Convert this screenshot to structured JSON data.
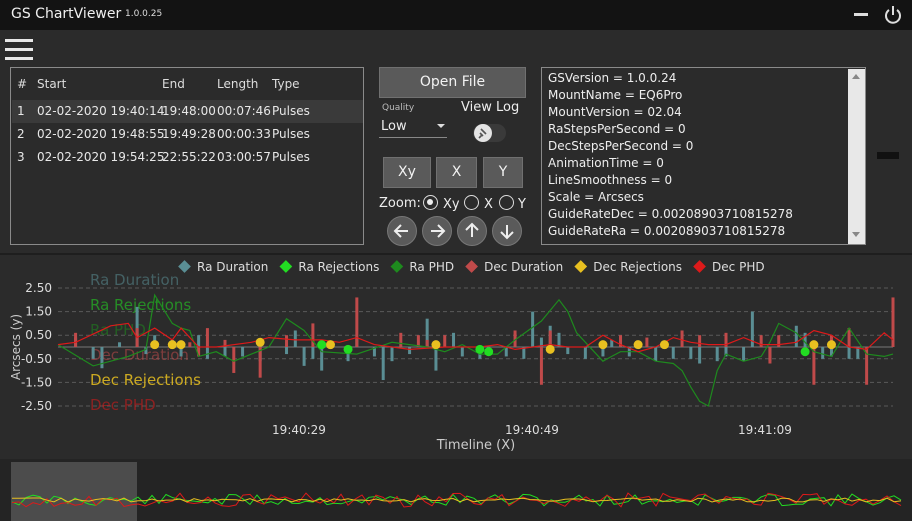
{
  "titlebar": {
    "title": "GS ChartViewer",
    "version": "1.0.0.25"
  },
  "table": {
    "columns": [
      "#",
      "Start",
      "End",
      "Length",
      "Type"
    ],
    "rows": [
      {
        "n": "1",
        "start": "02-02-2020 19:40:14",
        "end": "19:48:00",
        "length": "00:07:46",
        "type": "Pulses"
      },
      {
        "n": "2",
        "start": "02-02-2020 19:48:55",
        "end": "19:49:28",
        "length": "00:00:33",
        "type": "Pulses"
      },
      {
        "n": "3",
        "start": "02-02-2020 19:54:25",
        "end": "22:55:22",
        "length": "03:00:57",
        "type": "Pulses"
      }
    ]
  },
  "controls": {
    "open_file": "Open File",
    "quality_label": "Quality",
    "quality_value": "Low",
    "view_log": "View Log",
    "view_log_on": false,
    "axis_buttons": [
      "Xy",
      "X",
      "Y"
    ],
    "zoom_label": "Zoom:",
    "zoom_options": [
      "Xy",
      "X",
      "Y"
    ],
    "zoom_selected": "Xy"
  },
  "log": {
    "lines": [
      "GSVersion = 1.0.0.24",
      "MountName = EQ6Pro",
      "MountVersion = 02.04",
      "RaStepsPerSecond = 0",
      "DecStepsPerSecond = 0",
      "AnimationTime = 0",
      "LineSmoothness = 0",
      "Scale = Arcsecs",
      "GuideRateDec = 0.00208903710815278",
      "GuideRateRa = 0.00208903710815278"
    ]
  },
  "chart_data": {
    "type": "bar",
    "xlabel": "Timeline (X)",
    "ylabel": "Arcsecs (y)",
    "ylim": [
      -2.5,
      2.5
    ],
    "y_ticks": [
      "2.50",
      "1.50",
      "0.50",
      "-0.50",
      "-1.50",
      "-2.50"
    ],
    "y_tick_values": [
      2.5,
      1.5,
      0.5,
      -0.5,
      -1.5,
      -2.5
    ],
    "x_range": [
      0,
      50
    ],
    "x_ticks": [
      "19:40:29",
      "19:40:49",
      "19:41:09"
    ],
    "x_tick_values": [
      15,
      25,
      35
    ],
    "grid": true,
    "legend_position": "top",
    "colors": {
      "ra_duration": "#5a8e94",
      "ra_rejections": "#22dd22",
      "ra_phd": "#1e8a1e",
      "dec_duration": "#c04a4a",
      "dec_rejections": "#e8c020",
      "dec_phd": "#dd1a1a"
    },
    "legend": [
      {
        "name": "Ra Duration",
        "color": "#5a8e94",
        "shape": "diamond"
      },
      {
        "name": "Ra Rejections",
        "color": "#22dd22",
        "shape": "diamond"
      },
      {
        "name": "Ra PHD",
        "color": "#1e8a1e",
        "shape": "diamond"
      },
      {
        "name": "Dec Duration",
        "color": "#c04a4a",
        "shape": "diamond"
      },
      {
        "name": "Dec Rejections",
        "color": "#e8c020",
        "shape": "diamond"
      },
      {
        "name": "Dec PHD",
        "color": "#dd1a1a",
        "shape": "diamond"
      }
    ],
    "side_labels": [
      "Ra Duration",
      "Ra Rejections",
      "Ra PHD",
      "Dec Duration",
      "Dec Rejections",
      "Dec PHD"
    ],
    "series": [
      {
        "name": "Ra Duration",
        "kind": "bars",
        "points": [
          [
            2,
            0.4
          ],
          [
            4,
            -0.5
          ],
          [
            5,
            -0.9
          ],
          [
            7,
            0.2
          ],
          [
            9,
            1.7
          ],
          [
            10,
            -0.3
          ],
          [
            11,
            0.5
          ],
          [
            13,
            0.3
          ],
          [
            14,
            -0.4
          ],
          [
            16,
            0.5
          ],
          [
            17,
            -0.5
          ],
          [
            19,
            -0.4
          ],
          [
            21,
            -0.4
          ],
          [
            23,
            -0.6
          ],
          [
            26,
            -0.3
          ],
          [
            27,
            0.7
          ],
          [
            28,
            -0.8
          ],
          [
            29,
            -0.5
          ],
          [
            30,
            -1.0
          ],
          [
            33,
            -0.6
          ],
          [
            34,
            0.4
          ],
          [
            36,
            -0.4
          ],
          [
            37,
            -1.4
          ],
          [
            38,
            -0.6
          ],
          [
            40,
            -0.3
          ],
          [
            42,
            1.2
          ],
          [
            43,
            -1.0
          ],
          [
            45,
            0.6
          ],
          [
            46,
            -0.4
          ],
          [
            48,
            -0.5
          ],
          [
            49,
            -0.3
          ],
          [
            51,
            -0.4
          ],
          [
            53,
            -0.5
          ],
          [
            54,
            1.5
          ],
          [
            55,
            0.4
          ],
          [
            56,
            0.9
          ],
          [
            57,
            0.6
          ],
          [
            58,
            -0.3
          ],
          [
            60,
            -0.5
          ],
          [
            62,
            -0.4
          ],
          [
            63,
            0.3
          ],
          [
            65,
            -0.4
          ],
          [
            68,
            -0.6
          ],
          [
            70,
            -0.5
          ],
          [
            72,
            -0.5
          ],
          [
            73,
            -0.7
          ],
          [
            75,
            -0.6
          ],
          [
            76,
            -0.4
          ],
          [
            78,
            -0.6
          ],
          [
            79,
            1.5
          ],
          [
            81,
            -0.6
          ],
          [
            84,
            0.9
          ],
          [
            85,
            0.6
          ],
          [
            87,
            -0.5
          ],
          [
            88,
            -0.4
          ],
          [
            90,
            -0.5
          ],
          [
            91,
            -0.5
          ]
        ]
      },
      {
        "name": "Dec Duration",
        "kind": "bars",
        "points": [
          [
            2,
            0.6
          ],
          [
            9,
            0.8
          ],
          [
            15,
            0.2
          ],
          [
            16,
            -0.4
          ],
          [
            17,
            0.8
          ],
          [
            19,
            0.3
          ],
          [
            20,
            -1.1
          ],
          [
            23,
            -1.3
          ],
          [
            26,
            0.5
          ],
          [
            29,
            1.0
          ],
          [
            34,
            2.1
          ],
          [
            39,
            0.6
          ],
          [
            41,
            0.5
          ],
          [
            42,
            0.3
          ],
          [
            44,
            0.5
          ],
          [
            52,
            0.7
          ],
          [
            55,
            -1.6
          ],
          [
            56,
            0.7
          ],
          [
            64,
            0.5
          ],
          [
            67,
            0.4
          ],
          [
            71,
            0.7
          ],
          [
            73,
            0.5
          ],
          [
            76,
            0.6
          ],
          [
            80,
            0.5
          ],
          [
            81,
            -0.7
          ],
          [
            82,
            0.5
          ],
          [
            86,
            -1.6
          ],
          [
            88,
            0.5
          ],
          [
            90,
            0.8
          ],
          [
            92,
            -1.6
          ],
          [
            95,
            2.1
          ]
        ]
      },
      {
        "name": "Ra PHD",
        "kind": "line",
        "points": [
          [
            0,
            0.1
          ],
          [
            4,
            -0.8
          ],
          [
            8,
            -0.4
          ],
          [
            10,
            -0.1
          ],
          [
            11,
            2.2
          ],
          [
            12,
            1.6
          ],
          [
            13,
            1.0
          ],
          [
            14,
            0.8
          ],
          [
            15,
            0.7
          ],
          [
            16,
            -0.4
          ],
          [
            18,
            -0.2
          ],
          [
            20,
            -0.6
          ],
          [
            22,
            -0.3
          ],
          [
            24,
            0.0
          ],
          [
            26,
            1.2
          ],
          [
            28,
            0.7
          ],
          [
            30,
            -0.2
          ],
          [
            34,
            -0.3
          ],
          [
            38,
            0.2
          ],
          [
            42,
            0.0
          ],
          [
            44,
            -0.2
          ],
          [
            46,
            0.1
          ],
          [
            48,
            -0.3
          ],
          [
            50,
            -0.3
          ],
          [
            52,
            0.3
          ],
          [
            55,
            1.1
          ],
          [
            57,
            2.0
          ],
          [
            58,
            1.5
          ],
          [
            59,
            0.6
          ],
          [
            60,
            0.2
          ],
          [
            62,
            -0.6
          ],
          [
            63,
            -0.4
          ],
          [
            64,
            -0.2
          ],
          [
            66,
            -0.2
          ],
          [
            68,
            -0.6
          ],
          [
            70,
            -0.7
          ],
          [
            71,
            -1.0
          ],
          [
            72,
            -1.7
          ],
          [
            73,
            -2.3
          ],
          [
            74,
            -2.5
          ],
          [
            75,
            -1.0
          ],
          [
            76,
            -0.3
          ],
          [
            78,
            -0.6
          ],
          [
            80,
            -0.4
          ],
          [
            81,
            0.2
          ],
          [
            82,
            1.0
          ],
          [
            84,
            0.6
          ],
          [
            86,
            -0.2
          ],
          [
            88,
            -0.4
          ],
          [
            90,
            0.8
          ],
          [
            92,
            -0.3
          ],
          [
            94,
            -0.4
          ],
          [
            95,
            -0.3
          ]
        ]
      },
      {
        "name": "Dec PHD",
        "kind": "line",
        "points": [
          [
            0,
            0.1
          ],
          [
            2,
            0.2
          ],
          [
            6,
            0.9
          ],
          [
            8,
            1.0
          ],
          [
            9,
            0.4
          ],
          [
            11,
            0.8
          ],
          [
            13,
            0.3
          ],
          [
            14,
            0.8
          ],
          [
            16,
            0.0
          ],
          [
            18,
            0.0
          ],
          [
            22,
            0.2
          ],
          [
            24,
            0.4
          ],
          [
            27,
            0.3
          ],
          [
            30,
            0.3
          ],
          [
            32,
            0.2
          ],
          [
            34,
            0.4
          ],
          [
            36,
            0.1
          ],
          [
            40,
            -0.1
          ],
          [
            44,
            0.0
          ],
          [
            48,
            0.0
          ],
          [
            50,
            0.1
          ],
          [
            52,
            -0.1
          ],
          [
            54,
            0.0
          ],
          [
            56,
            0.1
          ],
          [
            58,
            0.0
          ],
          [
            60,
            0.0
          ],
          [
            62,
            0.5
          ],
          [
            64,
            0.1
          ],
          [
            66,
            -0.2
          ],
          [
            68,
            0.0
          ],
          [
            70,
            0.4
          ],
          [
            72,
            0.2
          ],
          [
            74,
            0.1
          ],
          [
            76,
            0.1
          ],
          [
            78,
            0.4
          ],
          [
            80,
            0.1
          ],
          [
            82,
            0.1
          ],
          [
            84,
            0.2
          ],
          [
            86,
            0.7
          ],
          [
            88,
            0.5
          ],
          [
            90,
            0.0
          ],
          [
            92,
            -0.1
          ],
          [
            94,
            0.6
          ],
          [
            95,
            0.3
          ]
        ]
      },
      {
        "name": "Dec Rejections",
        "kind": "points",
        "points": [
          [
            11,
            0.1
          ],
          [
            13,
            0.1
          ],
          [
            14,
            0.1
          ],
          [
            23,
            0.2
          ],
          [
            31,
            0.1
          ],
          [
            43,
            0.1
          ],
          [
            56,
            -0.1
          ],
          [
            62,
            0.1
          ],
          [
            66,
            0.1
          ],
          [
            69,
            0.1
          ],
          [
            86,
            0.1
          ],
          [
            88,
            0.1
          ]
        ]
      },
      {
        "name": "Ra Rejections",
        "kind": "points",
        "points": [
          [
            30,
            0.1
          ],
          [
            33,
            -0.1
          ],
          [
            48,
            -0.1
          ],
          [
            49,
            -0.2
          ],
          [
            85,
            -0.2
          ]
        ]
      }
    ]
  }
}
